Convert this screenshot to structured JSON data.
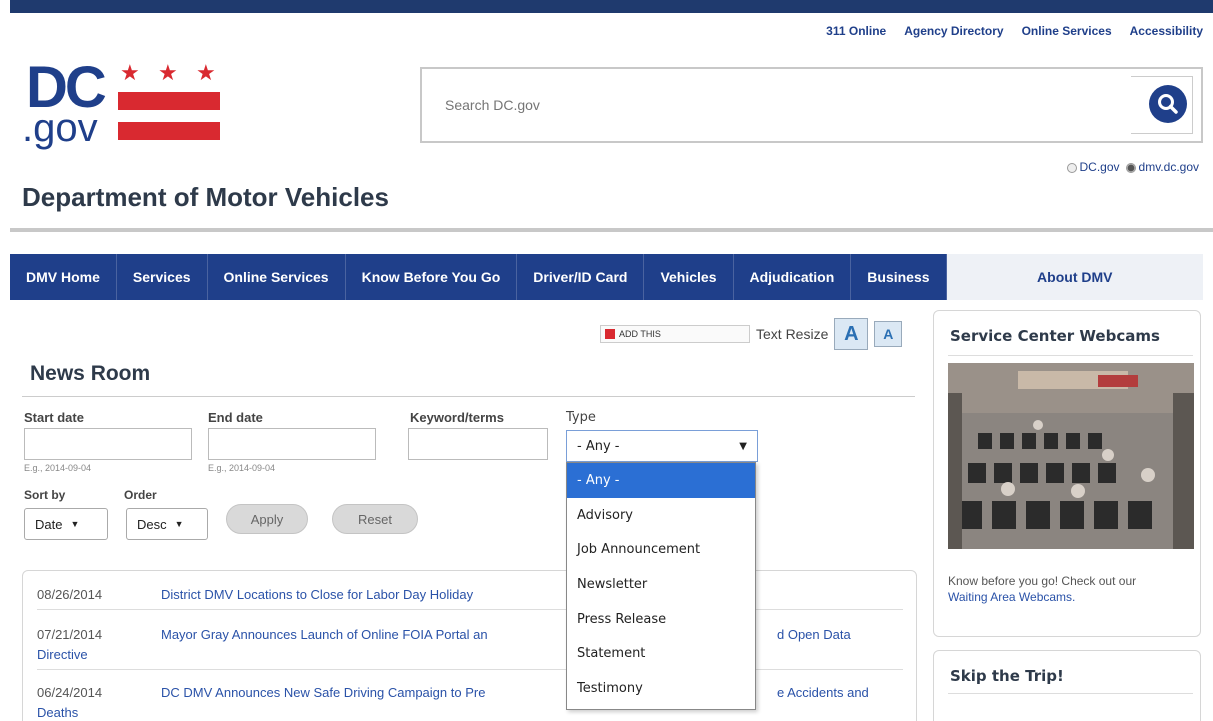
{
  "utility_links": [
    "311 Online",
    "Agency Directory",
    "Online Services",
    "Accessibility"
  ],
  "logo": {
    "dc": "DC",
    "gov": ".gov"
  },
  "search": {
    "placeholder": "Search DC.gov"
  },
  "scope": {
    "option1": "DC.gov",
    "option2": "dmv.dc.gov",
    "selected": "dmv.dc.gov"
  },
  "department": "Department of Motor Vehicles",
  "nav": [
    "DMV Home",
    "Services",
    "Online Services",
    "Know Before You Go",
    "Driver/ID Card",
    "Vehicles",
    "Adjudication",
    "Business",
    "About DMV"
  ],
  "nav_active": "About DMV",
  "share": {
    "addthis": "ADD THIS",
    "text_resize": "Text Resize",
    "a_large": "A",
    "a_small": "A"
  },
  "newsroom": {
    "title": "News Room",
    "start_date_label": "Start date",
    "end_date_label": "End date",
    "keyword_label": "Keyword/terms",
    "type_label": "Type",
    "start_hint": "E.g., 2014-09-04",
    "end_hint": "E.g., 2014-09-04",
    "sort_by_label": "Sort by",
    "order_label": "Order",
    "sort_by_value": "Date",
    "order_value": "Desc",
    "apply": "Apply",
    "reset": "Reset",
    "type_value": "- Any -",
    "type_options": [
      "- Any -",
      "Advisory",
      "Job Announcement",
      "Newsletter",
      "Press Release",
      "Statement",
      "Testimony"
    ]
  },
  "news_items": [
    {
      "date": "08/26/2014",
      "title": "District DMV Locations to Close for Labor Day Holiday"
    },
    {
      "date": "07/21/2014",
      "title": "Mayor Gray Announces Launch of Online FOIA Portal an",
      "title_tail": "d Open Data",
      "title_cont": "Directive"
    },
    {
      "date": "06/24/2014",
      "title": "DC DMV Announces New Safe Driving Campaign to Pre",
      "title_tail": "e Accidents and",
      "title_cont": "Deaths"
    }
  ],
  "sidebar": {
    "webcams_title": "Service Center Webcams",
    "webcams_text": "Know before you go!  Check out our",
    "webcams_link": "Waiting Area Webcams.",
    "skip_title": "Skip the Trip!"
  },
  "colors": {
    "brand_blue": "#1f3f8a",
    "brand_red": "#d92930",
    "dropdown_highlight": "#2b6fd4"
  }
}
